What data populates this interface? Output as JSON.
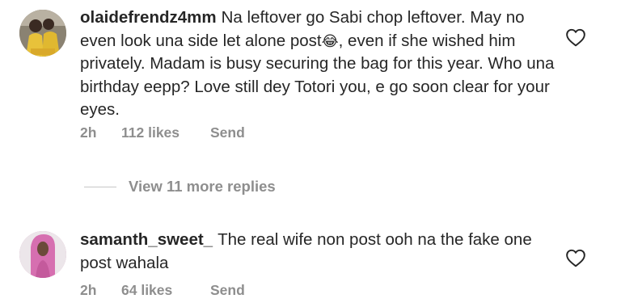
{
  "comments": [
    {
      "username": "olaidefrendz4mm",
      "text_before_emoji": "Na leftover go Sabi chop leftover. May no even look una side let alone post",
      "emoji": "😂",
      "text_after_emoji": ", even if she wished him privately. Madam is busy securing the bag for this year. Who una birthday eepp? Love still dey Totori you, e go soon clear for your eyes.",
      "time": "2h",
      "likes": "112 likes",
      "send": "Send",
      "like_icon": "heart-outline-icon"
    },
    {
      "username": "samanth_sweet_",
      "text": "The real wife non post ooh na the fake one post wahala",
      "time": "2h",
      "likes": "64 likes",
      "send": "Send",
      "like_icon": "heart-outline-icon"
    }
  ],
  "view_replies": {
    "label": "View 11 more replies"
  },
  "colors": {
    "text": "#262626",
    "meta": "#8e8e8e",
    "divider": "#c7c7c7"
  }
}
